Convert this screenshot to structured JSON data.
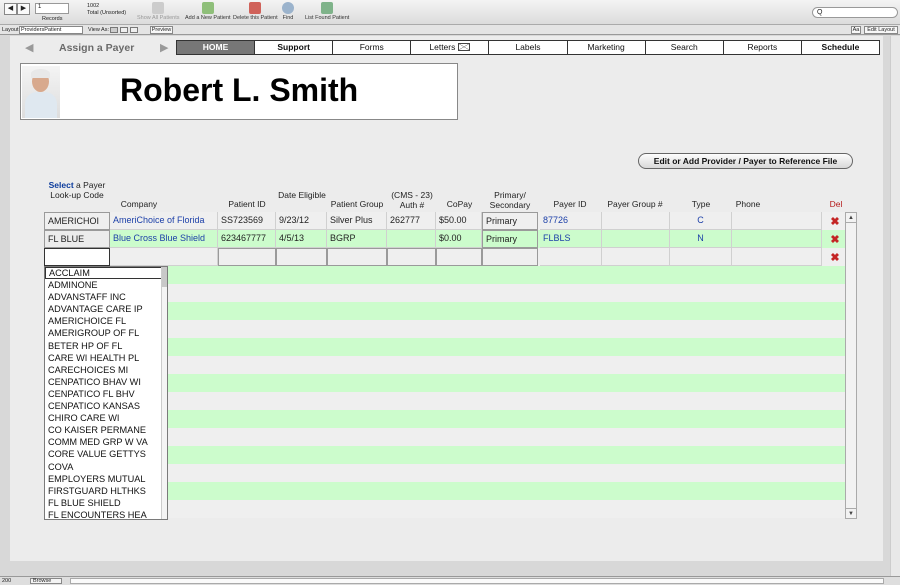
{
  "toolbar": {
    "record_field": "1",
    "records_label": "Records",
    "found_count": "1002",
    "found_status": "Total (Unsorted)",
    "tools": [
      {
        "label": "Show All Patients",
        "icon": "show-all-icon",
        "dim": true
      },
      {
        "label": "Add a New Patient",
        "icon": "new-record-icon",
        "dim": false
      },
      {
        "label": "Delete this Patient",
        "icon": "delete-record-icon",
        "dim": false
      },
      {
        "label": "Find",
        "icon": "find-icon",
        "dim": false
      },
      {
        "label": "List Found Patient",
        "icon": "list-found-icon",
        "dim": false
      }
    ],
    "search_placeholder": "Q"
  },
  "layoutbar": {
    "layout_label": "Layout:",
    "layout_value": "ProvidersPatient",
    "view_as_label": "View As:",
    "preview_label": "Preview",
    "aa_label": "Aa",
    "edit_layout_label": "Edit Layout"
  },
  "nav": {
    "assign_payer": "Assign a Payer",
    "tabs": [
      "HOME",
      "Support",
      "Forms",
      "Letters",
      "Labels",
      "Marketing",
      "Search",
      "Reports",
      "Schedule"
    ]
  },
  "patient": {
    "name": "Robert L. Smith"
  },
  "ref_button": "Edit or Add Provider / Payer to Reference File",
  "columns": {
    "lookup_select": "Select",
    "lookup_rest": " a Payer Look-up Code",
    "company": "Company",
    "patient_id": "Patient ID",
    "date_eligible": "Date Eligible",
    "patient_group": "Patient Group",
    "auth": "(CMS - 23) Auth #",
    "copay": "CoPay",
    "primary_secondary": "Primary/ Secondary",
    "payer_id": "Payer ID",
    "payer_group": "Payer Group #",
    "type": "Type",
    "phone": "Phone",
    "del": "Del"
  },
  "rows": [
    {
      "lookup": "AMERICHOI",
      "company": "AmeriChoice of Florida",
      "patient_id": "SS723569",
      "date": "9/23/12",
      "group": "Silver Plus",
      "auth": "262777",
      "copay": "$50.00",
      "primary": "Primary",
      "payer_id": "87726",
      "payer_group": "",
      "type": "C",
      "phone": ""
    },
    {
      "lookup": "FL BLUE",
      "company": "Blue Cross Blue Shield",
      "patient_id": "623467777",
      "date": "4/5/13",
      "group": "BGRP",
      "auth": "",
      "copay": "$0.00",
      "primary": "Primary",
      "payer_id": "FLBLS",
      "payer_group": "",
      "type": "N",
      "phone": ""
    },
    {
      "lookup": "",
      "company": "",
      "patient_id": "",
      "date": "",
      "group": "",
      "auth": "",
      "copay": "",
      "primary": "",
      "payer_id": "",
      "payer_group": "",
      "type": "",
      "phone": ""
    }
  ],
  "dropdown_options": [
    "ACCLAIM",
    "ADMINONE",
    "ADVANSTAFF INC",
    "ADVANTAGE CARE IP",
    "AMERICHOICE FL",
    "AMERIGROUP OF FL",
    "BETER HP OF FL",
    "CARE WI HEALTH PL",
    "CARECHOICES MI",
    "CENPATICO BHAV WI",
    "CENPATICO FL BHV",
    "CENPATICO KANSAS",
    "CHIRO CARE WI",
    "CO KAISER PERMANE",
    "COMM MED GRP W VA",
    "CORE VALUE GETTYS",
    "COVA",
    "EMPLOYERS MUTUAL",
    "FIRSTGUARD HLTHKS",
    "FL BLUE SHIELD",
    "FL ENCOUNTERS HEA"
  ],
  "statusbar": {
    "zoom": "200",
    "mode": "Browse"
  },
  "colors": {
    "green_row": "#ccfccc",
    "blue_text": "#1b3fa8",
    "delete_red": "#c42525"
  }
}
